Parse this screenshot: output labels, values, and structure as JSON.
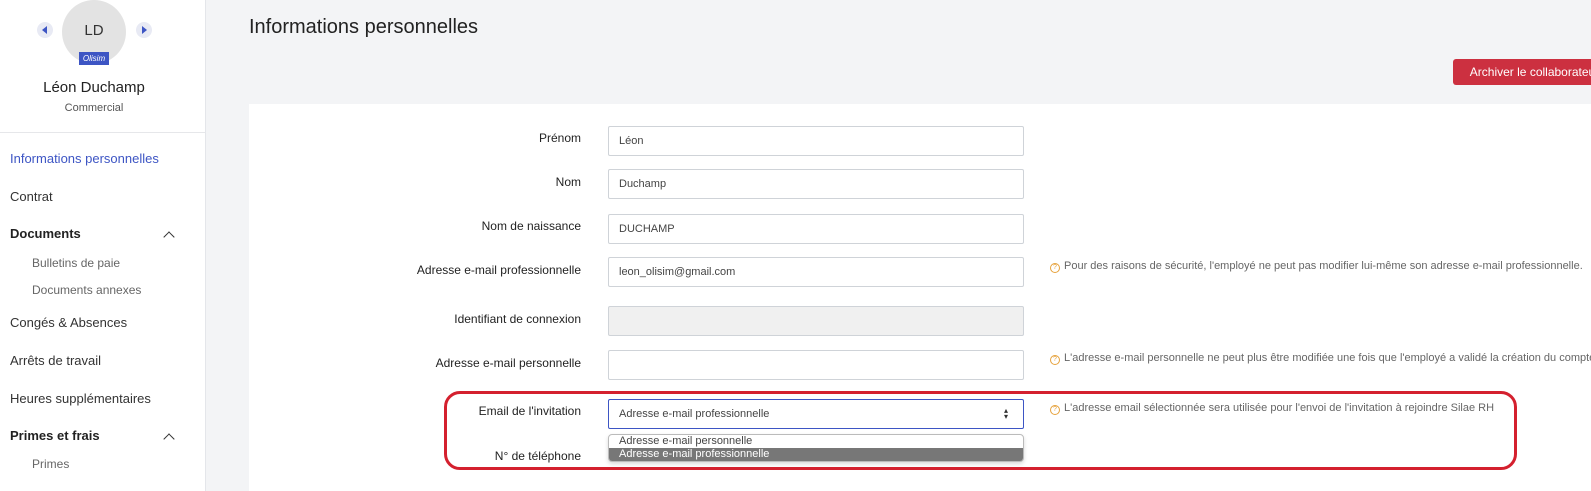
{
  "profile": {
    "initials": "LD",
    "company_badge": "Olisim",
    "name": "Léon Duchamp",
    "role": "Commercial"
  },
  "sidebar": {
    "items": [
      {
        "label": "Informations personnelles"
      },
      {
        "label": "Contrat"
      },
      {
        "label": "Documents"
      },
      {
        "label": "Bulletins de paie"
      },
      {
        "label": "Documents annexes"
      },
      {
        "label": "Congés & Absences"
      },
      {
        "label": "Arrêts de travail"
      },
      {
        "label": "Heures supplémentaires"
      },
      {
        "label": "Primes et frais"
      },
      {
        "label": "Primes"
      }
    ]
  },
  "main": {
    "title": "Informations personnelles",
    "archive_label": "Archiver le collaborateur"
  },
  "form": {
    "first_name": {
      "label": "Prénom",
      "value": "Léon"
    },
    "last_name": {
      "label": "Nom",
      "value": "Duchamp"
    },
    "birth_name": {
      "label": "Nom de naissance",
      "value": "DUCHAMP"
    },
    "pro_email": {
      "label": "Adresse e-mail professionnelle",
      "value": "leon_olisim@gmail.com",
      "help": "Pour des raisons de sécurité, l'employé ne peut pas modifier lui-même son adresse e-mail professionnelle."
    },
    "login_id": {
      "label": "Identifiant de connexion",
      "value": ""
    },
    "personal_email": {
      "label": "Adresse e-mail personnelle",
      "value": "",
      "help": "L'adresse e-mail personnelle ne peut plus être modifiée une fois que l'employé a validé la création du compte."
    },
    "invitation_email": {
      "label": "Email de l'invitation",
      "value": "Adresse e-mail professionnelle",
      "help": "L'adresse email sélectionnée sera utilisée pour l'envoi de l'invitation à rejoindre Silae RH",
      "options": [
        "Adresse e-mail personnelle",
        "Adresse e-mail professionnelle"
      ]
    },
    "phone": {
      "label": "N° de téléphone"
    }
  },
  "colors": {
    "accent": "#3d55c4",
    "danger": "#cc3040",
    "highlight": "#d4202e",
    "help_icon": "#e6a23c"
  }
}
